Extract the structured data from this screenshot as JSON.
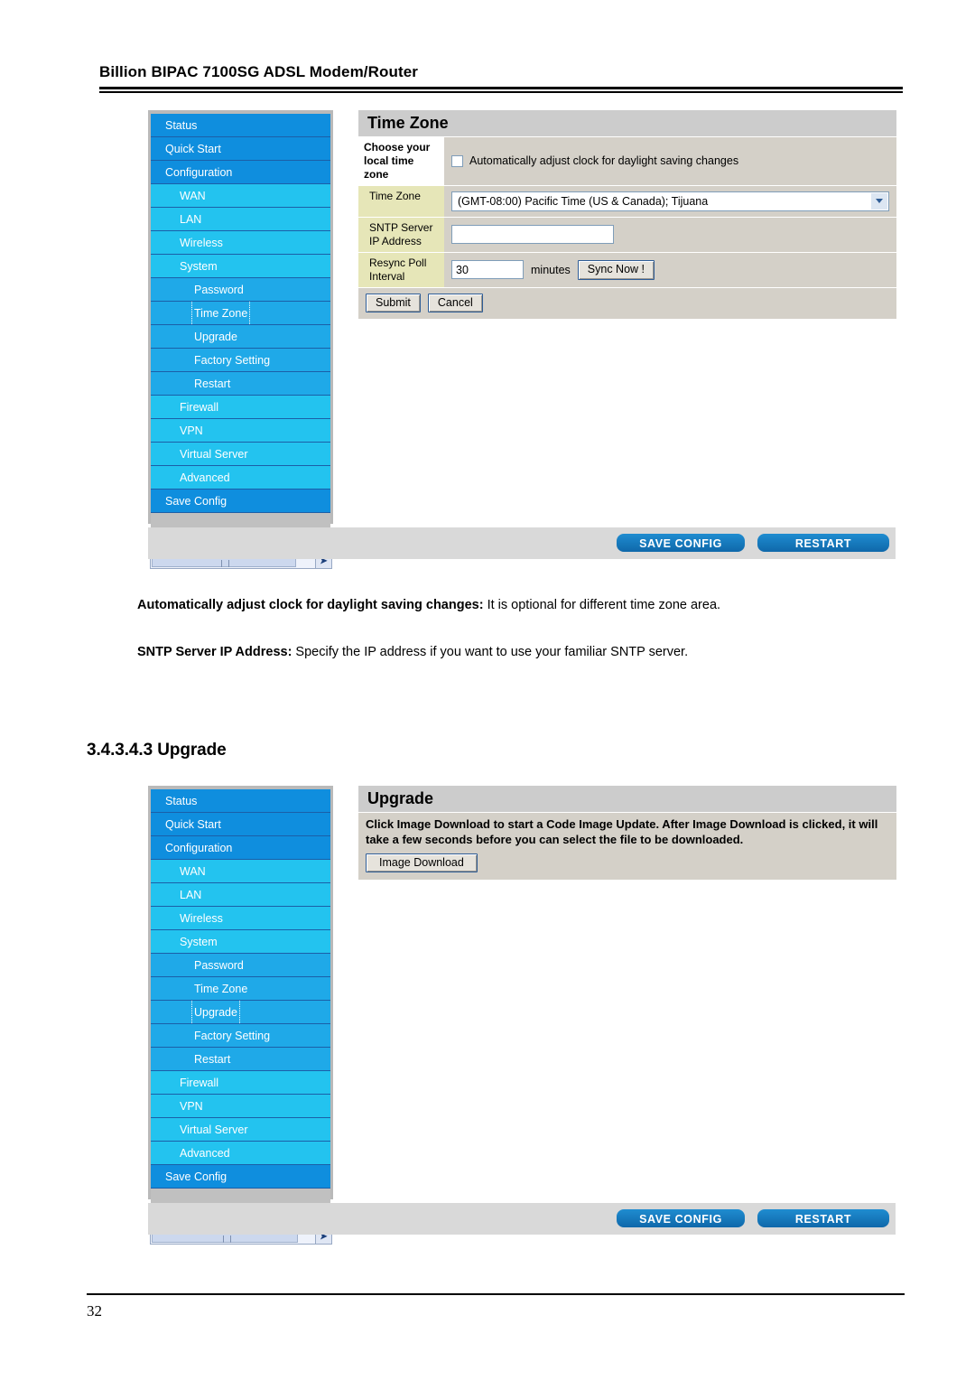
{
  "document": {
    "header_title": "Billion BIPAC 7100SG ADSL Modem/Router",
    "page_number": "32",
    "section_heading": "3.4.3.4.3 Upgrade",
    "paragraphs": [
      {
        "term": "Automatically adjust clock for daylight saving changes:",
        "text": " It is optional for different time zone area."
      },
      {
        "term": "SNTP Server IP Address:",
        "text": " Specify the IP address if you want to use your familiar SNTP server."
      }
    ]
  },
  "nav": {
    "items": [
      {
        "label": "Status",
        "level": 0
      },
      {
        "label": "Quick Start",
        "level": 0
      },
      {
        "label": "Configuration",
        "level": 0
      },
      {
        "label": "WAN",
        "level": 1
      },
      {
        "label": "LAN",
        "level": 1
      },
      {
        "label": "Wireless",
        "level": 1
      },
      {
        "label": "System",
        "level": 1
      },
      {
        "label": "Password",
        "level": 2
      },
      {
        "label": "Time Zone",
        "level": 2
      },
      {
        "label": "Upgrade",
        "level": 2
      },
      {
        "label": "Factory Setting",
        "level": 2
      },
      {
        "label": "Restart",
        "level": 2
      },
      {
        "label": "Firewall",
        "level": 1
      },
      {
        "label": "VPN",
        "level": 1
      },
      {
        "label": "Virtual Server",
        "level": 1
      },
      {
        "label": "Advanced",
        "level": 1
      },
      {
        "label": "Save Config",
        "level": 0
      }
    ]
  },
  "timezone_screen": {
    "panel_title": "Time Zone",
    "rows": {
      "choose_label": "Choose your local time zone",
      "daylight_checkbox_label": "Automatically adjust clock for daylight saving changes",
      "daylight_checked": false,
      "timezone_label": "Time Zone",
      "timezone_value": "(GMT-08:00) Pacific Time (US & Canada); Tijuana",
      "sntp_label": "SNTP Server IP Address",
      "sntp_value": "",
      "resync_label": "Resync Poll Interval",
      "resync_value": "30",
      "resync_unit": "minutes",
      "sync_button": "Sync Now !"
    },
    "submit_button": "Submit",
    "cancel_button": "Cancel",
    "save_config_button": "SAVE CONFIG",
    "restart_button": "RESTART"
  },
  "upgrade_screen": {
    "panel_title": "Upgrade",
    "description": "Click Image Download to start a Code Image Update. After Image Download is clicked, it will take a few seconds before you can select the file to be downloaded.",
    "image_download_button": "Image Download",
    "save_config_button": "SAVE CONFIG",
    "restart_button": "RESTART"
  },
  "colors": {
    "nav_level0": "#0f8ede",
    "nav_level1": "#23c3ef",
    "nav_level2": "#1fa9e8",
    "panel_bg": "#d4d0c8",
    "panel_title_bg": "#cccccc",
    "label_khaki": "#e6e6b8",
    "pill_blue": "#1277bc"
  }
}
